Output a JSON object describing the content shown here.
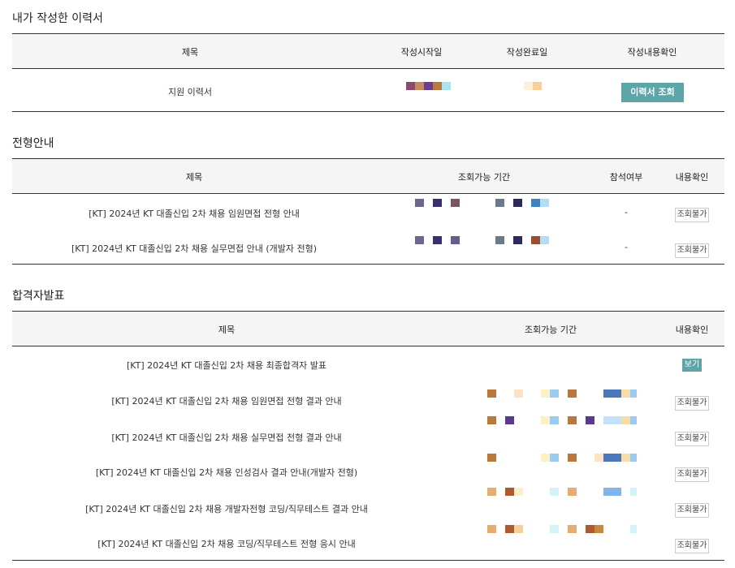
{
  "resume": {
    "title": "내가 작성한 이력서",
    "headers": [
      "제목",
      "작성시작일",
      "작성완료일",
      "작성내용확인"
    ],
    "row": {
      "title": "지원 이력서",
      "button": "이력서 조회"
    }
  },
  "guide": {
    "title": "전형안내",
    "headers": [
      "제목",
      "조회가능 기간",
      "참석여부",
      "내용확인"
    ],
    "rows": [
      {
        "title": "[KT] 2024년 KT 대졸신입 2차 채용 임원면접 전형 안내",
        "attend": "-",
        "button": "조회불가"
      },
      {
        "title": "[KT] 2024년 KT 대졸신입 2차 채용 실무면접 안내 (개발자 전형)",
        "attend": "-",
        "button": "조회불가"
      }
    ]
  },
  "results": {
    "title": "합격자발표",
    "headers": [
      "제목",
      "조회가능 기간",
      "내용확인"
    ],
    "rows": [
      {
        "title": "[KT] 2024년 KT 대졸신입 2차 채용 최종합격자 발표",
        "button": "보기"
      },
      {
        "title": "[KT] 2024년 KT 대졸신입 2차 채용 임원면접 전형 결과 안내",
        "button": "조회불가"
      },
      {
        "title": "[KT] 2024년 KT 대졸신입 2차 채용 실무면접 전형 결과 안내",
        "button": "조회불가"
      },
      {
        "title": "[KT] 2024년 KT 대졸신입 2차 채용 인성검사 결과 안내(개발자 전형)",
        "button": "조회불가"
      },
      {
        "title": "[KT] 2024년 KT 대졸신입 2차 채용 개발자전형 코딩/직무테스트 결과 안내",
        "button": "조회불가"
      },
      {
        "title": "[KT] 2024년 KT 대졸신입 2차 채용 코딩/직무테스트 전형 응시 안내",
        "button": "조회불가"
      }
    ]
  },
  "colors": {
    "accent": "#5ca5a8",
    "border": "#333333",
    "header_bg": "#f5f5f5"
  }
}
